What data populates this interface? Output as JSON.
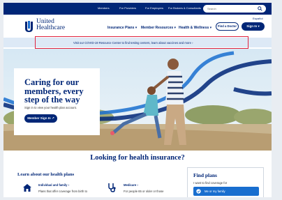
{
  "utility_nav": {
    "links": [
      "Members",
      "For Providers",
      "For Employers",
      "For Brokers & Consultants"
    ],
    "search_placeholder": "Search",
    "search_icon": "search-icon"
  },
  "header": {
    "brand_line1": "United",
    "brand_line2": "Healthcare",
    "espanol": "Español",
    "nav": [
      "Insurance Plans",
      "Member Resources",
      "Health & Wellness"
    ],
    "find_doctor": "Find a Doctor",
    "sign_in": "Sign In"
  },
  "banner": {
    "text": "Visit our COVID-19 Resource Center to find testing centers, learn about vaccines and more"
  },
  "hero": {
    "title": "Caring for our members, every step of the way",
    "subtitle": "Sign in to view your health plan account.",
    "button": "Member Sign In"
  },
  "main": {
    "headline": "Looking for health insurance?",
    "learn_heading": "Learn about our health plans",
    "plans": [
      {
        "title": "Individual and family",
        "desc": "Plans that offer coverage from birth to",
        "icon": "house-icon"
      },
      {
        "title": "Medicare",
        "desc": "For people 65 or older or those",
        "icon": "stethoscope-icon"
      }
    ]
  },
  "find_plans": {
    "title": "Find plans",
    "question": "I want to find coverage for",
    "option": "Me or my family"
  },
  "colors": {
    "brand_navy": "#002677",
    "banner_bg": "#dde9f6",
    "highlight": "#e0213d",
    "option_blue": "#196ecf"
  }
}
